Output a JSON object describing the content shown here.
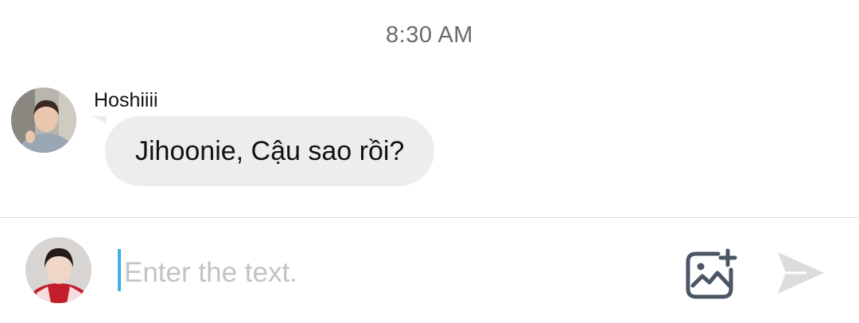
{
  "timestamp": "8:30 AM",
  "message": {
    "sender_name": "Hoshiiii",
    "text": "Jihoonie, Cậu sao rồi?"
  },
  "composer": {
    "placeholder": "Enter the text.",
    "value": ""
  },
  "icons": {
    "image_add": "image-plus-icon",
    "send": "send-arrow-icon"
  },
  "colors": {
    "bubble": "#ededed",
    "caret": "#3cb1e8",
    "icon": "#4a5566",
    "send_disabled": "#dcdcdc"
  }
}
